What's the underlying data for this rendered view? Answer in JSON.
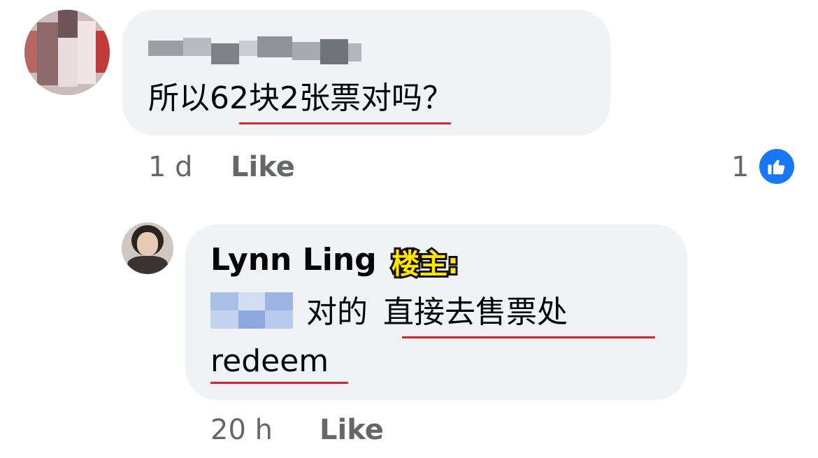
{
  "comment1": {
    "author_blurred": "Vicky Leung",
    "text_parts": [
      "所以",
      "62块2张票",
      "对吗？"
    ],
    "time": "1 d",
    "like_label": "Like",
    "reaction_count": "1",
    "reaction_icon": "thumbs-up-icon"
  },
  "reply1": {
    "author": "Lynn Ling",
    "author_tag": "楼主:",
    "mention_blurred": "Vicky",
    "text_part1": "对的",
    "text_part2": "直接去售票处",
    "text_line2": "redeem",
    "time": "20 h",
    "like_label": "Like"
  },
  "colors": {
    "bubble_bg": "#f0f2f5",
    "meta_text": "#65676b",
    "underline": "#d8282f",
    "like_blue": "#1877f2",
    "tag_yellow": "#ffe600"
  }
}
